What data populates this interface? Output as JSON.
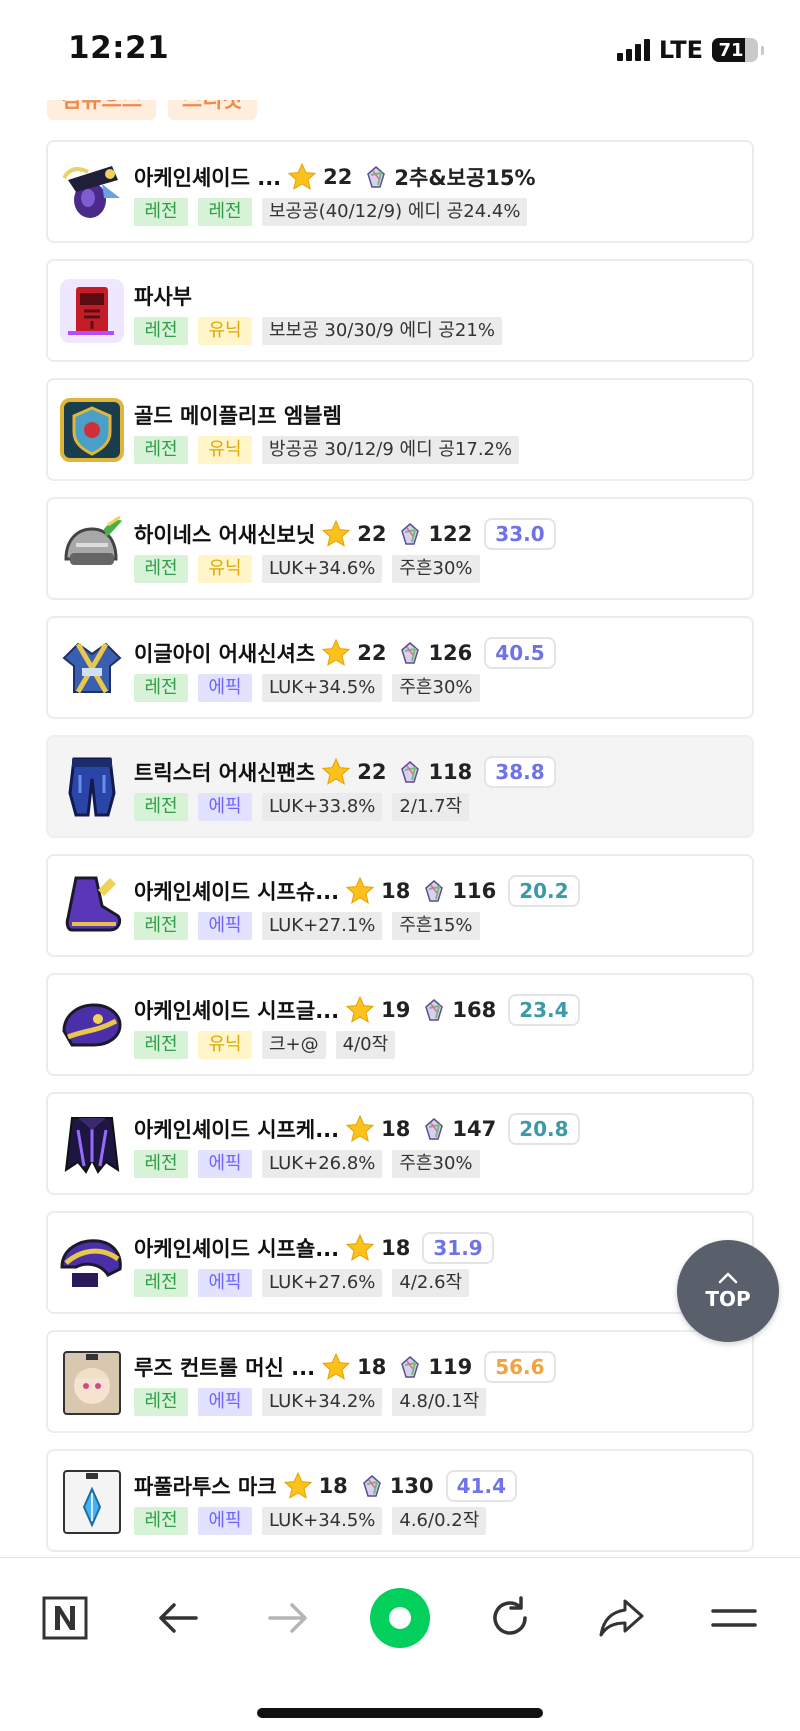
{
  "status_bar": {
    "time": "12:21",
    "network": "LTE",
    "battery": "71",
    "battery_level": 0.71
  },
  "filters": [
    "컴퓨으스",
    "스티갓"
  ],
  "items": [
    {
      "name": "아케인셰이드 ...",
      "icon": "arcane-thief-hat-icon",
      "stars": "22",
      "stat": "2추&보공15%",
      "score": "",
      "score_color": "",
      "grade1": "레전",
      "grade2": "레전",
      "grade2_type": "legend",
      "info": [
        "보공공(40/12/9) 에디 공24.4%"
      ]
    },
    {
      "name": "파사부",
      "icon": "scroll-talisman-icon",
      "stars": "",
      "stat": "",
      "score": "",
      "score_color": "",
      "grade1": "레전",
      "grade2": "유닉",
      "grade2_type": "unique",
      "info": [
        "보보공 30/30/9 에디 공21%"
      ]
    },
    {
      "name": "골드 메이플리프 엠블렘",
      "icon": "emblem-icon",
      "stars": "",
      "stat": "",
      "score": "",
      "score_color": "",
      "grade1": "레전",
      "grade2": "유닉",
      "grade2_type": "unique",
      "info": [
        "방공공 30/12/9 에디 공17.2%"
      ]
    },
    {
      "name": "하이네스 어새신보닛",
      "icon": "assassin-bonnet-icon",
      "stars": "22",
      "stat": "122",
      "score": "33.0",
      "score_color": "#6f73e6",
      "grade1": "레전",
      "grade2": "유닉",
      "grade2_type": "unique",
      "info": [
        "LUK+34.6%",
        "주흔30%"
      ]
    },
    {
      "name": "이글아이 어새신셔츠",
      "icon": "assassin-shirt-icon",
      "stars": "22",
      "stat": "126",
      "score": "40.5",
      "score_color": "#6f73e6",
      "grade1": "레전",
      "grade2": "에픽",
      "grade2_type": "epic",
      "info": [
        "LUK+34.5%",
        "주흔30%"
      ]
    },
    {
      "name": "트릭스터 어새신팬츠",
      "icon": "assassin-pants-icon",
      "stars": "22",
      "stat": "118",
      "score": "38.8",
      "score_color": "#6f73e6",
      "grade1": "레전",
      "grade2": "에픽",
      "grade2_type": "epic",
      "info": [
        "LUK+33.8%",
        "2/1.7작"
      ],
      "selected": true
    },
    {
      "name": "아케인셰이드 시프슈...",
      "icon": "thief-shoes-icon",
      "stars": "18",
      "stat": "116",
      "score": "20.2",
      "score_color": "#3a9aa8",
      "grade1": "레전",
      "grade2": "에픽",
      "grade2_type": "epic",
      "info": [
        "LUK+27.1%",
        "주흔15%"
      ]
    },
    {
      "name": "아케인셰이드 시프글...",
      "icon": "thief-gloves-icon",
      "stars": "19",
      "stat": "168",
      "score": "23.4",
      "score_color": "#3a9aa8",
      "grade1": "레전",
      "grade2": "유닉",
      "grade2_type": "unique",
      "info": [
        "크+@",
        "4/0작"
      ]
    },
    {
      "name": "아케인셰이드 시프케...",
      "icon": "thief-cape-icon",
      "stars": "18",
      "stat": "147",
      "score": "20.8",
      "score_color": "#3a9aa8",
      "grade1": "레전",
      "grade2": "에픽",
      "grade2_type": "epic",
      "info": [
        "LUK+26.8%",
        "주흔30%"
      ]
    },
    {
      "name": "아케인셰이드 시프숄...",
      "icon": "thief-shoulder-icon",
      "stars": "18",
      "stat": "",
      "score": "31.9",
      "score_color": "#6f73e6",
      "grade1": "레전",
      "grade2": "에픽",
      "grade2_type": "epic",
      "info": [
        "LUK+27.6%",
        "4/2.6작"
      ]
    },
    {
      "name": "루즈 컨트롤 머신 ...",
      "icon": "face-badge-icon",
      "stars": "18",
      "stat": "119",
      "score": "56.6",
      "score_color": "#f0a340",
      "grade1": "레전",
      "grade2": "에픽",
      "grade2_type": "epic",
      "info": [
        "LUK+34.2%",
        "4.8/0.1작"
      ]
    },
    {
      "name": "파풀라투스 마크",
      "icon": "crystal-badge-icon",
      "stars": "18",
      "stat": "130",
      "score": "41.4",
      "score_color": "#6f73e6",
      "grade1": "레전",
      "grade2": "에픽",
      "grade2_type": "epic",
      "info": [
        "LUK+34.5%",
        "4.6/0.2작"
      ]
    }
  ],
  "top_button": {
    "label": "TOP"
  },
  "colors": {
    "legend": "#2f9e49",
    "unique": "#e0a700",
    "epic": "#6f64ff",
    "naver_green": "#03cf5d"
  }
}
